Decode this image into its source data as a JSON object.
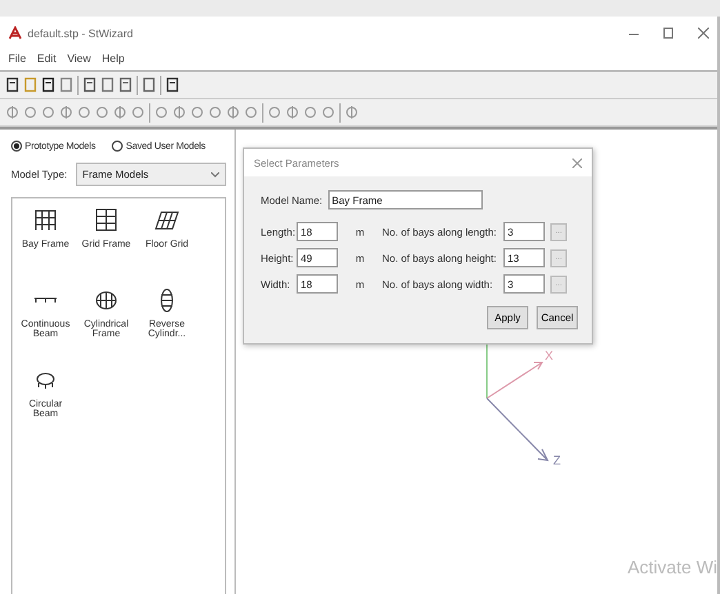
{
  "window": {
    "title": "default.stp - StWizard"
  },
  "menu": [
    "File",
    "Edit",
    "View",
    "Help"
  ],
  "model_source": [
    {
      "label": "Prototype Models",
      "selected": true
    },
    {
      "label": "Saved User Models",
      "selected": false
    }
  ],
  "model_type": {
    "label": "Model Type:",
    "value": "Frame Models"
  },
  "models": [
    {
      "label": "Bay Frame",
      "kind": "bay"
    },
    {
      "label": "Grid Frame",
      "kind": "grid"
    },
    {
      "label": "Floor Grid",
      "kind": "floor"
    },
    {
      "label": "Continuous Beam",
      "kind": "beam"
    },
    {
      "label": "Cylindrical Frame",
      "kind": "cyl"
    },
    {
      "label": "Reverse Cylindr...",
      "kind": "rcyl"
    },
    {
      "label": "Circular Beam",
      "kind": "circ"
    }
  ],
  "dialog": {
    "title": "Select Parameters",
    "model_name": {
      "label": "Model Name:",
      "value": "Bay Frame"
    },
    "rows": [
      {
        "label": "Length:",
        "value": "18",
        "unit": "m",
        "bays_label": "No. of bays along length:",
        "bays_value": "3"
      },
      {
        "label": "Height:",
        "value": "49",
        "unit": "m",
        "bays_label": "No. of bays along height:",
        "bays_value": "13"
      },
      {
        "label": "Width:",
        "value": "18",
        "unit": "m",
        "bays_label": "No. of bays along width:",
        "bays_value": "3"
      }
    ],
    "browse": "...",
    "buttons": [
      "Apply",
      "Cancel"
    ]
  },
  "axes": {
    "x": "X",
    "z": "Z"
  },
  "activation": [
    "Activate Wi"
  ]
}
